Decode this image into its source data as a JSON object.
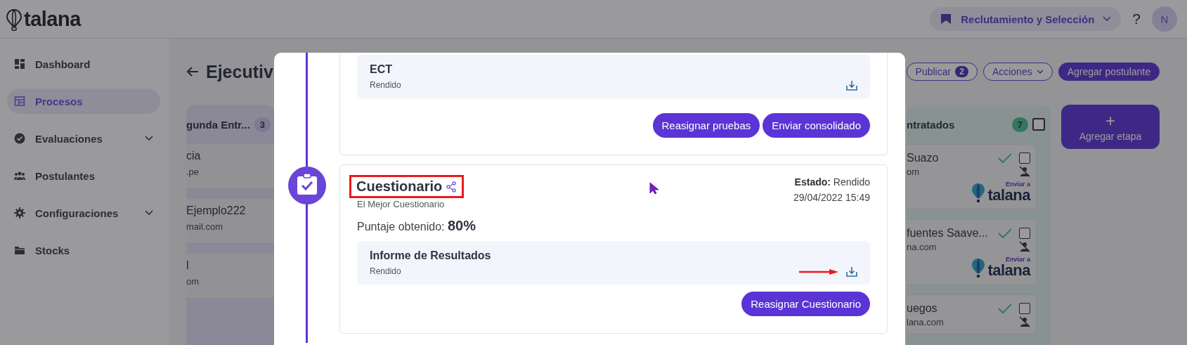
{
  "header": {
    "logo": "talana",
    "module": "Reclutamiento y Selección",
    "help": "?",
    "avatar": "N"
  },
  "sidebar": {
    "items": [
      {
        "label": "Dashboard",
        "selected": false,
        "expandable": false
      },
      {
        "label": "Procesos",
        "selected": true,
        "expandable": false
      },
      {
        "label": "Evaluaciones",
        "selected": false,
        "expandable": true
      },
      {
        "label": "Postulantes",
        "selected": false,
        "expandable": false
      },
      {
        "label": "Configuraciones",
        "selected": false,
        "expandable": true
      },
      {
        "label": "Stocks",
        "selected": false,
        "expandable": false
      }
    ]
  },
  "page": {
    "title": "Ejecutiv",
    "actions": [
      {
        "kind": "outline",
        "label": "Publicar",
        "count": "2"
      },
      {
        "kind": "dropdown",
        "label": "Acciones"
      },
      {
        "kind": "primary",
        "label": "Agregar postulante"
      }
    ]
  },
  "board": {
    "columns": [
      {
        "title": "gunda Entr...",
        "count": "3",
        "selectable": false,
        "cards": [
          {
            "name": "cia",
            "email": ".pe"
          },
          {
            "name": "Ejemplo222",
            "email": "mail.com"
          },
          {
            "name": "l",
            "email": "om"
          }
        ]
      },
      {
        "title": "ntratados",
        "count": "7",
        "selectable": true,
        "checked": false,
        "cards": [
          {
            "name": "Suazo",
            "email": "om",
            "approved": true,
            "checked": false,
            "send_to": {
              "line1": "Enviar a",
              "line2": "talana"
            }
          },
          {
            "name": "fuentes Saave...",
            "email": "na.com",
            "approved": true,
            "checked": false,
            "send_to": {
              "line1": "Enviar a",
              "line2": "talana"
            }
          },
          {
            "name": "uegos",
            "email": "lana.com",
            "approved": true,
            "checked": false
          }
        ]
      }
    ],
    "add_stage": {
      "icon": "+",
      "label": "Agregar etapa"
    }
  },
  "modal": {
    "steps": [
      {
        "kind": "tests",
        "items": [
          {
            "title": "ECT",
            "status": "Rendido"
          }
        ],
        "buttons": [
          "Reasignar pruebas",
          "Enviar consolidado"
        ]
      },
      {
        "kind": "questionnaire",
        "title": "Cuestionario",
        "subtitle": "El Mejor Cuestionario",
        "state_label": "Estado:",
        "state": "Rendido",
        "date": "29/04/2022 15:49",
        "score_label": "Puntaje obtenido:",
        "score": "80%",
        "items": [
          {
            "title": "Informe de Resultados",
            "status": "Rendido"
          }
        ],
        "buttons": [
          "Reasignar Cuestionario"
        ]
      }
    ]
  }
}
